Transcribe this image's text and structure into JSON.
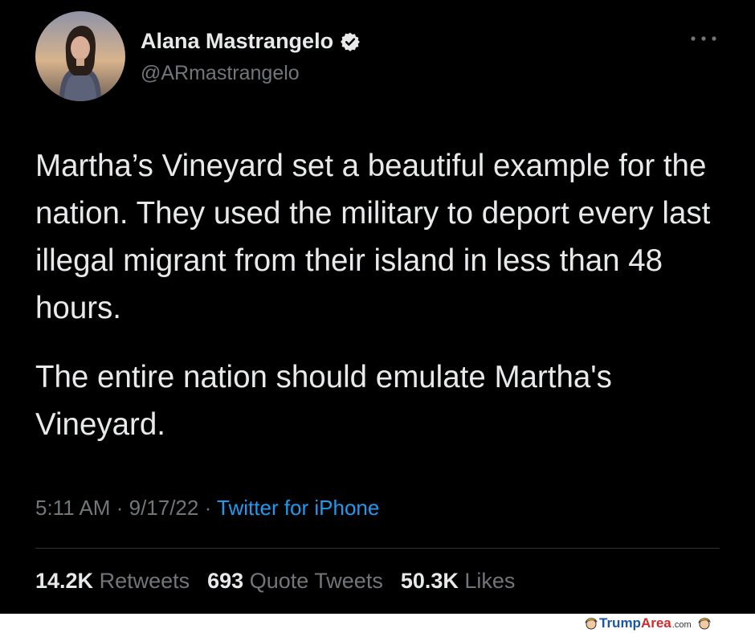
{
  "user": {
    "name": "Alana Mastrangelo",
    "handle": "@ARmastrangelo"
  },
  "tweet": {
    "paragraphs": [
      "Martha’s Vineyard set a beautiful example for the nation. They used the military to deport every last illegal migrant from their island in less than 48 hours.",
      "The entire nation should emulate Martha's Vineyard."
    ],
    "time": "5:11 AM",
    "date": "9/17/22",
    "separator": "·",
    "source": "Twitter for iPhone"
  },
  "stats": {
    "retweets_count": "14.2K",
    "retweets_label": "Retweets",
    "quotes_count": "693",
    "quotes_label": "Quote Tweets",
    "likes_count": "50.3K",
    "likes_label": "Likes"
  },
  "watermark": {
    "part1": "Trump",
    "part2": "Area",
    "part3": ".com"
  },
  "colors": {
    "background": "#000000",
    "text": "#e7e9ea",
    "muted": "#71767b",
    "link": "#1d9bf0"
  },
  "icons": [
    "avatar",
    "verified-badge-icon",
    "more-options-icon",
    "mascot-icon"
  ]
}
